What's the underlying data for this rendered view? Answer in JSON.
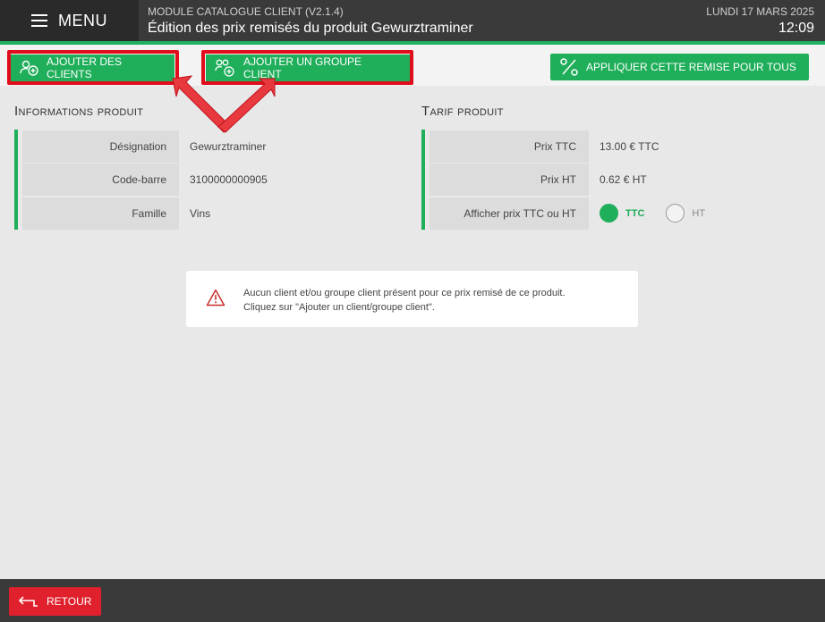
{
  "header": {
    "menu_label": "MENU",
    "module_title": "MODULE CATALOGUE CLIENT (V2.1.4)",
    "page_title": "Édition des prix remisés du produit Gewurztraminer",
    "date": "LUNDI 17 MARS 2025",
    "time": "12:09"
  },
  "toolbar": {
    "add_clients_label": "AJOUTER DES CLIENTS",
    "add_group_label": "AJOUTER UN GROUPE CLIENT",
    "apply_all_label": "APPLIQUER CETTE REMISE POUR TOUS"
  },
  "product_info": {
    "title": "Informations produit",
    "rows": [
      {
        "label": "Désignation",
        "value": "Gewurztraminer"
      },
      {
        "label": "Code-barre",
        "value": "3100000000905"
      },
      {
        "label": "Famille",
        "value": "Vins"
      }
    ]
  },
  "product_tariff": {
    "title": "Tarif produit",
    "rows": [
      {
        "label": "Prix TTC",
        "value": "13.00 € TTC"
      },
      {
        "label": "Prix HT",
        "value": "0.62 € HT"
      }
    ],
    "display_label": "Afficher prix TTC ou HT",
    "option_ttc": "TTC",
    "option_ht": "HT",
    "selected": "TTC"
  },
  "alert": {
    "line1": "Aucun client et/ou groupe client présent pour ce prix remisé de ce produit.",
    "line2": "Cliquez sur \"Ajouter un client/groupe client\"."
  },
  "footer": {
    "back_label": "RETOUR"
  },
  "colors": {
    "accent": "#1fae5a",
    "danger": "#e0202c",
    "header_bg": "#3a3a3a"
  }
}
